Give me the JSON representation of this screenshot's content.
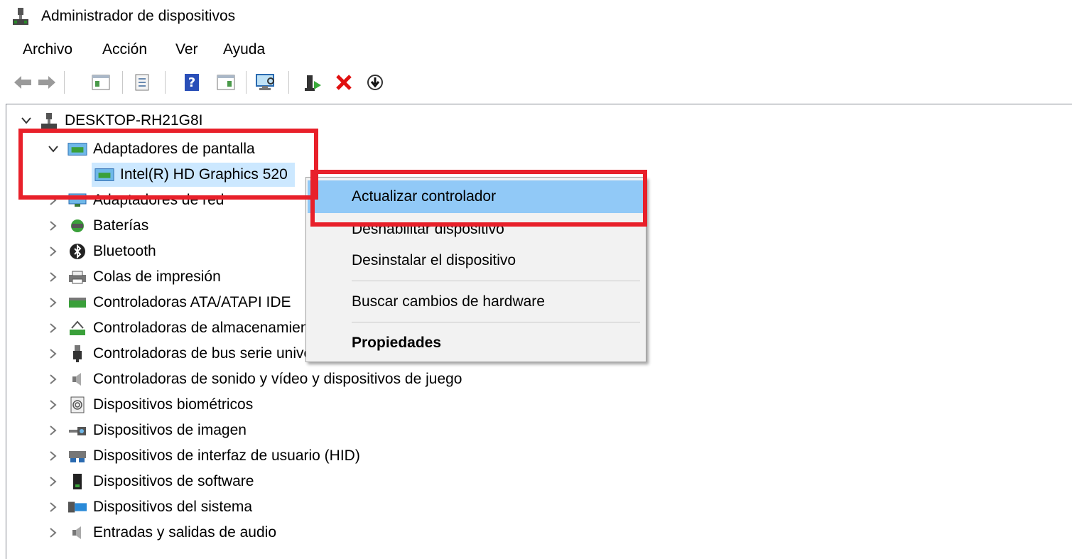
{
  "window": {
    "title": "Administrador de dispositivos"
  },
  "menu": [
    "Archivo",
    "Acción",
    "Ver",
    "Ayuda"
  ],
  "toolbar": {
    "buttons": [
      "back-icon",
      "forward-icon",
      "show-hide-console-tree-icon",
      "properties-icon",
      "help-icon",
      "action-pane-icon",
      "scan-hardware-icon",
      "update-driver-icon",
      "uninstall-icon",
      "disable-device-icon"
    ]
  },
  "tree": {
    "root": "DESKTOP-RH21G8I",
    "expanded_category": "Adaptadores de pantalla",
    "selected_device": "Intel(R) HD Graphics 520",
    "categories": [
      "Adaptadores de red",
      "Baterías",
      "Bluetooth",
      "Colas de impresión",
      "Controladoras ATA/ATAPI IDE",
      "Controladoras de almacenamiento",
      "Controladoras de bus serie universal",
      "Controladoras de sonido y vídeo y dispositivos de juego",
      "Dispositivos biométricos",
      "Dispositivos de imagen",
      "Dispositivos de interfaz de usuario (HID)",
      "Dispositivos de software",
      "Dispositivos del sistema",
      "Entradas y salidas de audio"
    ]
  },
  "context_menu": {
    "items": [
      "Actualizar controlador",
      "Deshabilitar dispositivo",
      "Desinstalar el dispositivo",
      "Buscar cambios de hardware",
      "Propiedades"
    ],
    "highlighted": "Actualizar controlador"
  },
  "colors": {
    "highlight": "#91c9f7",
    "annotation": "#e8202a",
    "selection": "#cce8ff"
  }
}
